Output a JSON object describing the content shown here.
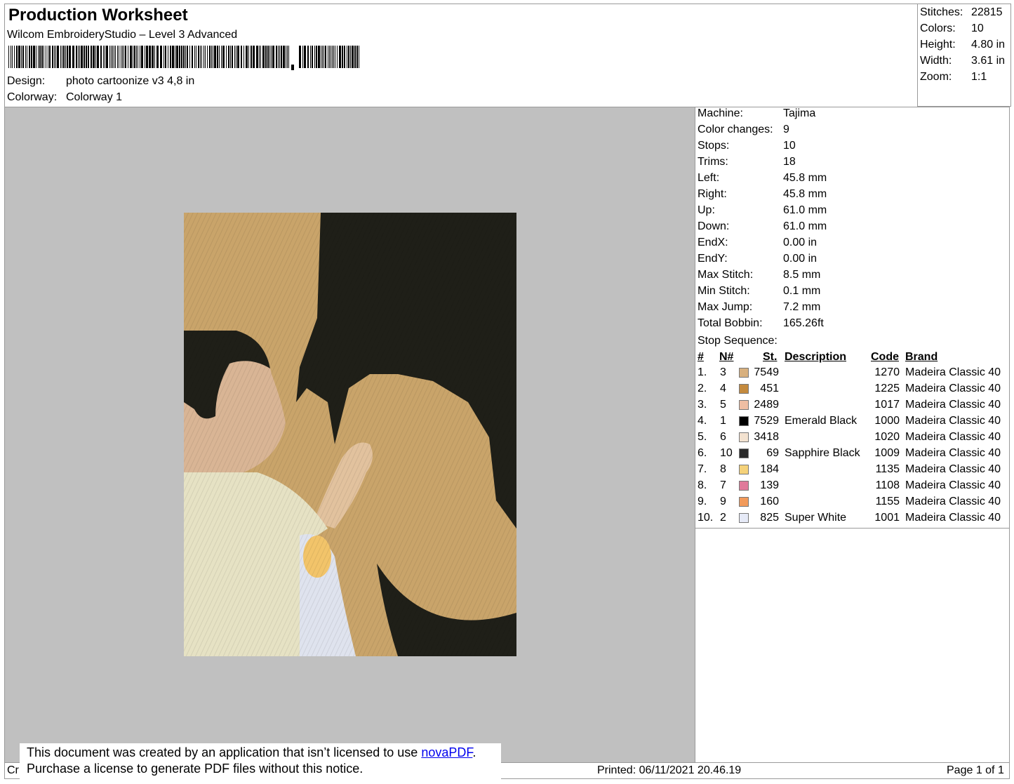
{
  "header": {
    "title": "Production Worksheet",
    "software": "Wilcom EmbroideryStudio – Level 3 Advanced",
    "barcode_text": "|||||||||||||||||||||||||||||||||||||||||||||||||,|||||||||||",
    "design_label": "Design:",
    "design_value": "photo cartoonize v3 4,8 in",
    "colorway_label": "Colorway:",
    "colorway_value": "Colorway 1"
  },
  "summary": [
    {
      "label": "Stitches:",
      "value": "22815"
    },
    {
      "label": "Colors:",
      "value": "10"
    },
    {
      "label": "Height:",
      "value": "4.80 in"
    },
    {
      "label": "Width:",
      "value": "3.61 in"
    },
    {
      "label": "Zoom:",
      "value": "1:1"
    }
  ],
  "machine_info": [
    {
      "label": "Machine:",
      "value": "Tajima"
    },
    {
      "label": "Color changes:",
      "value": "9"
    },
    {
      "label": "Stops:",
      "value": "10"
    },
    {
      "label": "Trims:",
      "value": "18"
    },
    {
      "label": "Left:",
      "value": "45.8 mm"
    },
    {
      "label": "Right:",
      "value": "45.8 mm"
    },
    {
      "label": "Up:",
      "value": "61.0 mm"
    },
    {
      "label": "Down:",
      "value": "61.0 mm"
    },
    {
      "label": "EndX:",
      "value": "0.00 in"
    },
    {
      "label": "EndY:",
      "value": "0.00 in"
    },
    {
      "label": "Max Stitch:",
      "value": "8.5 mm"
    },
    {
      "label": "Min Stitch:",
      "value": "0.1 mm"
    },
    {
      "label": "Max Jump:",
      "value": "7.2 mm"
    },
    {
      "label": "Total Bobbin:",
      "value": "165.26ft"
    }
  ],
  "stop_sequence": {
    "title": "Stop Sequence:",
    "columns": [
      "#",
      "N#",
      "St.",
      "Description",
      "Code",
      "Brand"
    ],
    "rows": [
      {
        "idx": "1.",
        "n": "3",
        "color": "#d8b07e",
        "st": "7549",
        "desc": "",
        "code": "1270",
        "brand": "Madeira Classic 40"
      },
      {
        "idx": "2.",
        "n": "4",
        "color": "#c48a3e",
        "st": "451",
        "desc": "",
        "code": "1225",
        "brand": "Madeira Classic 40"
      },
      {
        "idx": "3.",
        "n": "5",
        "color": "#efbea3",
        "st": "2489",
        "desc": "",
        "code": "1017",
        "brand": "Madeira Classic 40"
      },
      {
        "idx": "4.",
        "n": "1",
        "color": "#000000",
        "st": "7529",
        "desc": "Emerald Black",
        "code": "1000",
        "brand": "Madeira Classic 40"
      },
      {
        "idx": "5.",
        "n": "6",
        "color": "#f3e2d0",
        "st": "3418",
        "desc": "",
        "code": "1020",
        "brand": "Madeira Classic 40"
      },
      {
        "idx": "6.",
        "n": "10",
        "color": "#2a2a2a",
        "st": "69",
        "desc": "Sapphire Black",
        "code": "1009",
        "brand": "Madeira Classic 40"
      },
      {
        "idx": "7.",
        "n": "8",
        "color": "#f5d27a",
        "st": "184",
        "desc": "",
        "code": "1135",
        "brand": "Madeira Classic 40"
      },
      {
        "idx": "8.",
        "n": "7",
        "color": "#e07a9a",
        "st": "139",
        "desc": "",
        "code": "1108",
        "brand": "Madeira Classic 40"
      },
      {
        "idx": "9.",
        "n": "9",
        "color": "#f29a5a",
        "st": "160",
        "desc": "",
        "code": "1155",
        "brand": "Madeira Classic 40"
      },
      {
        "idx": "10.",
        "n": "2",
        "color": "#e6eaf7",
        "st": "825",
        "desc": "Super White",
        "code": "1001",
        "brand": "Madeira Classic 40"
      }
    ]
  },
  "footer": {
    "left_cut": "Cr",
    "printed": "Printed: 06/11/2021 20.46.19",
    "page": "Page 1 of 1"
  },
  "notice": {
    "line1_prefix": "This document was created by an application that isn’t licensed to use ",
    "link": "novaPDF",
    "line1_suffix": ".",
    "line2": "Purchase a license to generate PDF files without this notice."
  },
  "colors": {
    "canvas_bg": "#c0c0c0",
    "skin_mother": "#c9a46a",
    "hair": "#1e1e18",
    "baby_skin": "#d9b595",
    "baby_shirt": "#e6e2c4"
  }
}
